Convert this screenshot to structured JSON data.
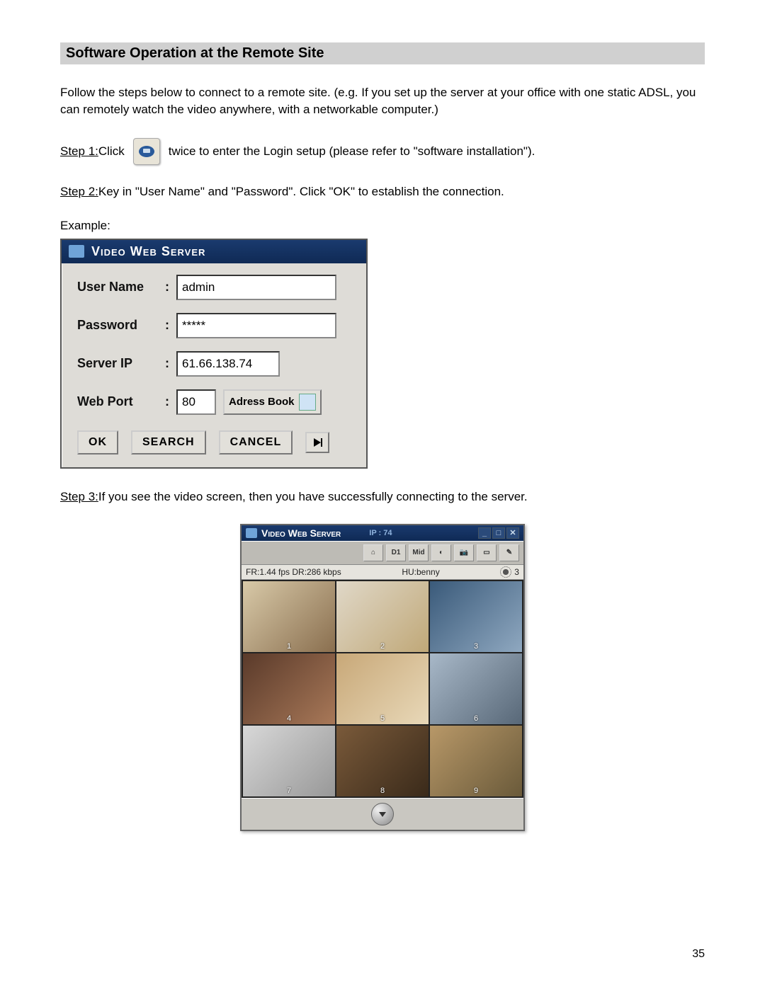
{
  "header": {
    "title": "Software Operation at the Remote Site"
  },
  "intro": "Follow the steps below to connect to a remote site.  (e.g.  If you set up the server at your office with one static ADSL, you can remotely watch the video anywhere, with a networkable computer.)",
  "steps": {
    "s1_label": "Step 1:",
    "s1_a": "  Click",
    "s1_b": "twice to enter the Login setup (please refer to \"software installation\").",
    "s2_label": "Step 2:",
    "s2_text": "  Key in \"User Name\" and \"Password\".  Click \"OK\" to establish the connection.",
    "s3_label": "Step 3:",
    "s3_text": "  If you see the video screen, then you have successfully connecting to the server."
  },
  "example_label": "Example:",
  "login": {
    "title": "Video Web Server",
    "fields": {
      "username_label": "User Name",
      "username_value": "admin",
      "password_label": "Password",
      "password_value": "*****",
      "serverip_label": "Server IP",
      "serverip_value": "61.66.138.74",
      "webport_label": "Web Port",
      "webport_value": "80",
      "addrbook_label": "Adress Book"
    },
    "buttons": {
      "ok": "OK",
      "search": "SEARCH",
      "cancel": "CANCEL"
    }
  },
  "viewer": {
    "title": "Video Web Server",
    "ip": "IP : 74",
    "toolbar": {
      "b1": "⌂",
      "b2": "D1",
      "b3": "Mid",
      "b4": "◐",
      "b5": "📷",
      "b6": "▭",
      "b7": "✎"
    },
    "status": {
      "left": "FR:1.44 fps DR:286 kbps",
      "mid": "HU:benny",
      "right": "3"
    },
    "cams": [
      "1",
      "2",
      "3",
      "4",
      "5",
      "6",
      "7",
      "8",
      "9"
    ]
  },
  "page_number": "35"
}
